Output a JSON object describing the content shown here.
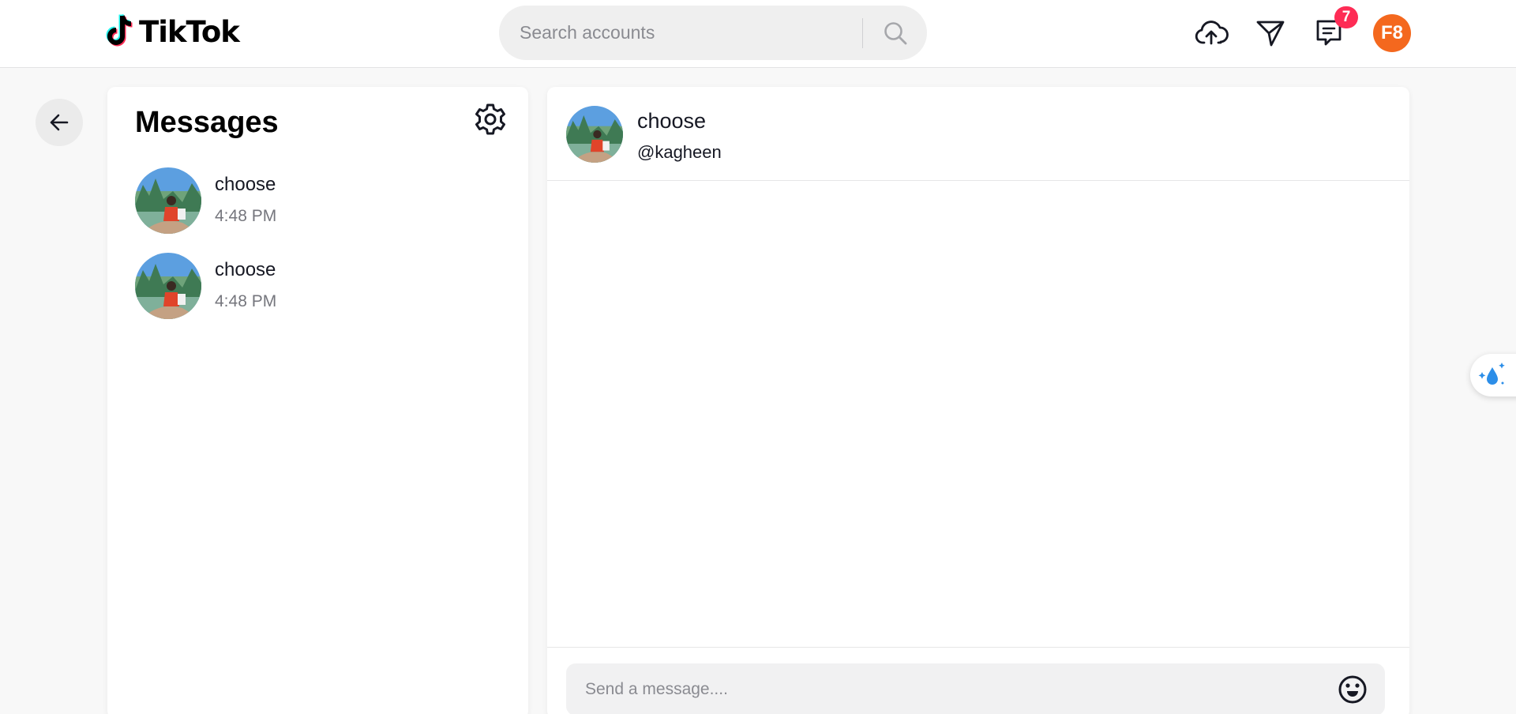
{
  "brand": {
    "name": "TikTok"
  },
  "search": {
    "placeholder": "Search accounts"
  },
  "header": {
    "notifications_count": "7",
    "user_initials": "F8"
  },
  "messages_panel": {
    "title": "Messages",
    "conversations": [
      {
        "name": "choose",
        "time": "4:48 PM"
      },
      {
        "name": "choose",
        "time": "4:48 PM"
      }
    ]
  },
  "chat": {
    "name": "choose",
    "handle": "@kagheen",
    "input_placeholder": "Send a message...."
  },
  "colors": {
    "accent": "#fe2c55",
    "avatar_bg": "#f4681e",
    "logo_cyan": "#25f4ee",
    "panel_bg": "#f8f8f8"
  },
  "icons": [
    "tiktok-logo",
    "search-icon",
    "upload-cloud-icon",
    "send-icon",
    "inbox-icon",
    "arrow-left-icon",
    "gear-icon",
    "emoji-icon",
    "droplet-sparkle-icon"
  ]
}
